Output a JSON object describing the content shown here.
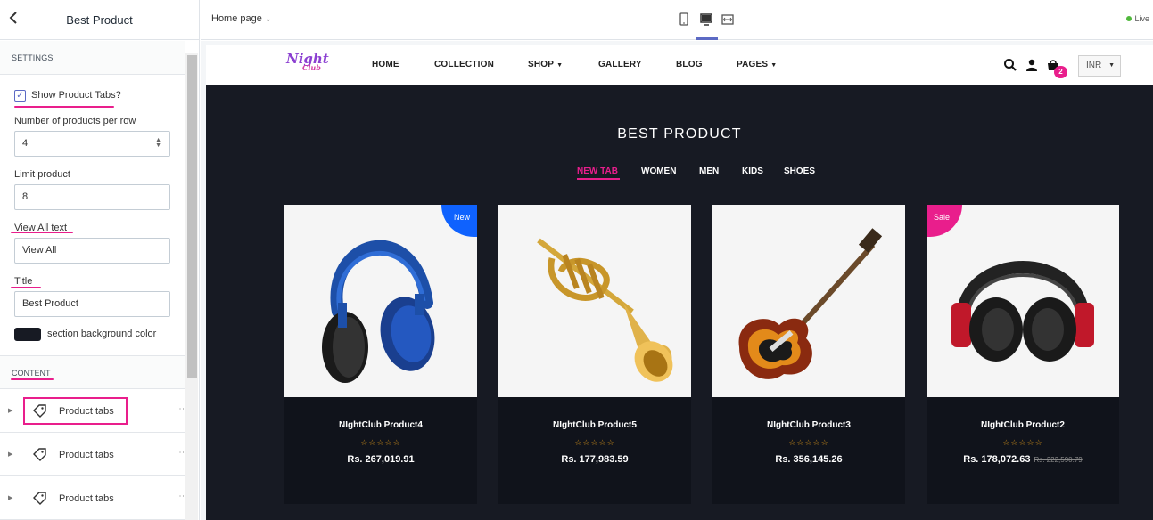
{
  "sidebar": {
    "title": "Best Product",
    "settings_heading": "SETTINGS",
    "show_tabs_label": "Show Product Tabs?",
    "per_row_label": "Number of products per row",
    "per_row_value": "4",
    "limit_label": "Limit product",
    "limit_value": "8",
    "view_all_label": "View All text",
    "view_all_value": "View All",
    "title_label": "Title",
    "title_value": "Best Product",
    "bg_color_label": "section background color",
    "bg_color": "#171a23",
    "content_heading": "CONTENT",
    "blocks": [
      {
        "label": "Product tabs",
        "icon": "tag-icon"
      },
      {
        "label": "Product tabs",
        "icon": "tag-icon"
      },
      {
        "label": "Product tabs",
        "icon": "tag-icon"
      }
    ]
  },
  "topbar": {
    "page_select": "Home page",
    "devices": [
      "mobile-icon",
      "desktop-icon",
      "fullwidth-icon"
    ],
    "status": "Live"
  },
  "store": {
    "logo_main": "Night",
    "logo_sub": "Club",
    "nav": [
      "HOME",
      "COLLECTION",
      "SHOP",
      "GALLERY",
      "BLOG",
      "PAGES"
    ],
    "cart_count": "2",
    "currency": "INR"
  },
  "section": {
    "title": "BEST PRODUCT",
    "tabs": [
      "NEW TAB",
      "WOMEN",
      "MEN",
      "KIDS",
      "SHOES"
    ],
    "products": [
      {
        "name": "NIghtClub Product4",
        "price": "Rs. 267,019.91",
        "old_price": "",
        "badge": "New",
        "image": "headphones-blue"
      },
      {
        "name": "NIghtClub Product5",
        "price": "Rs. 177,983.59",
        "old_price": "",
        "badge": "",
        "image": "trumpet"
      },
      {
        "name": "NIghtClub Product3",
        "price": "Rs. 356,145.26",
        "old_price": "",
        "badge": "",
        "image": "electric-guitar"
      },
      {
        "name": "NIghtClub Product2",
        "price": "Rs. 178,072.63",
        "old_price": "Rs. 222,590.79",
        "badge": "Sale",
        "image": "headphones-red"
      }
    ],
    "stars": "☆☆☆☆☆"
  },
  "colors": {
    "accent": "#e91e8c",
    "new_badge": "#0f62fe",
    "editor_accent": "#5c6ac4"
  }
}
